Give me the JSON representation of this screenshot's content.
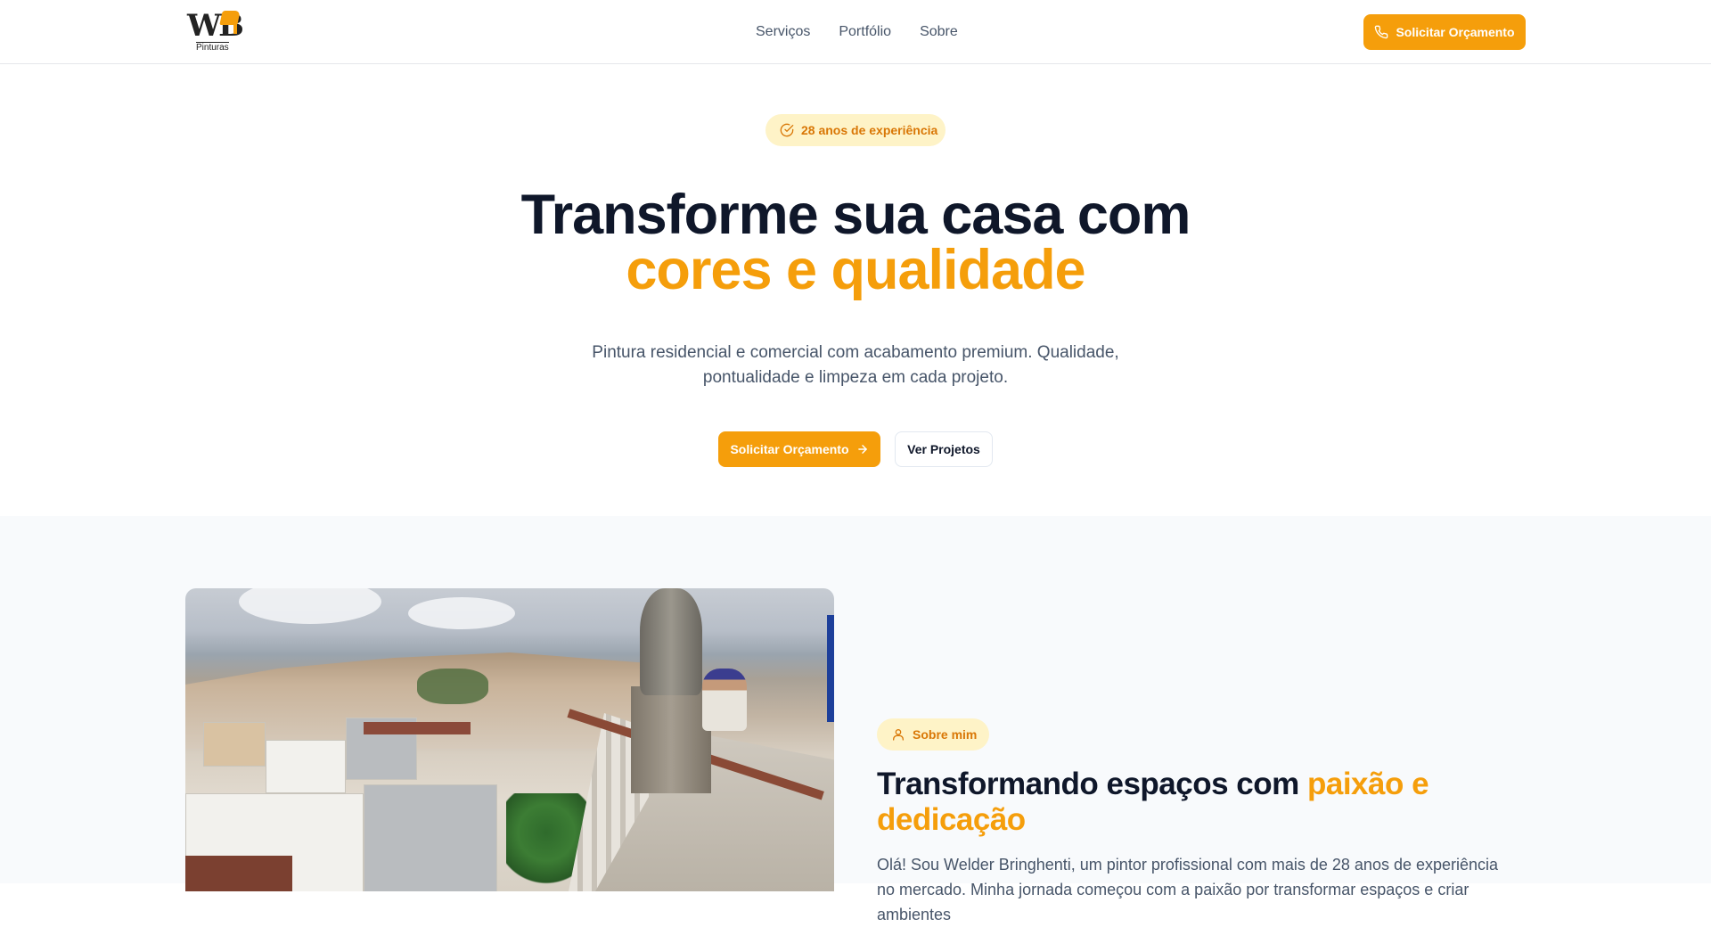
{
  "header": {
    "logo_text": "WB",
    "logo_sub": "Pinturas",
    "nav": [
      "Serviços",
      "Portfólio",
      "Sobre"
    ],
    "cta_label": "Solicitar Orçamento",
    "cta_icon": "phone-icon"
  },
  "hero": {
    "badge": "28 anos de experiência",
    "badge_icon": "check-circle-icon",
    "title_line1": "Transforme sua casa com",
    "title_line2": "cores e qualidade",
    "subtitle": "Pintura residencial e comercial com acabamento premium. Qualidade, pontualidade e limpeza em cada projeto.",
    "cta_label": "Solicitar Orçamento",
    "cta_icon": "arrow-right-icon",
    "secondary_label": "Ver Projetos"
  },
  "about": {
    "badge": "Sobre mim",
    "badge_icon": "user-icon",
    "title_part1": "Transformando espaços com ",
    "title_highlight": "paixão e dedicação",
    "text": "Olá! Sou Welder Bringhenti, um pintor profissional com mais de 28 anos de experiência no mercado. Minha jornada começou com a paixão por transformar espaços e criar ambientes"
  },
  "colors": {
    "accent": "#f59e0b",
    "accent_light": "#fef3c7",
    "heading": "#0f172a",
    "body_text": "#475569",
    "section_bg": "#f8fafc"
  }
}
